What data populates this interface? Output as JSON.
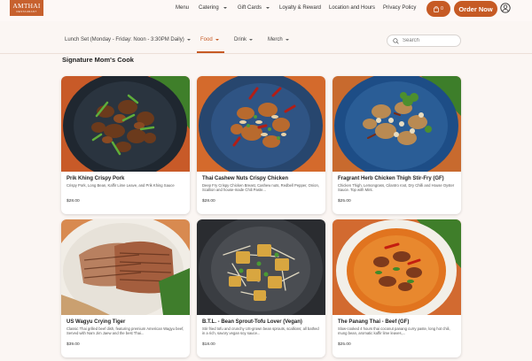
{
  "header": {
    "logo_main": "AMTHAI",
    "logo_sub": "RESTAURANT",
    "nav": [
      {
        "label": "Menu",
        "has_caret": false
      },
      {
        "label": "Catering",
        "has_caret": true
      },
      {
        "label": "Gift Cards",
        "has_caret": true
      },
      {
        "label": "Loyalty & Reward",
        "has_caret": false
      },
      {
        "label": "Location and Hours",
        "has_caret": false
      },
      {
        "label": "Privacy Policy",
        "has_caret": false
      }
    ],
    "cart_count": "0",
    "order_label": "Order Now",
    "account_icon": "user-circle-icon",
    "cart_icon": "shopping-bag-icon"
  },
  "categories": [
    {
      "label": "Lunch Set (Monday - Friday: Noon - 3:30PM Daily)",
      "active": false
    },
    {
      "label": "Food",
      "active": true
    },
    {
      "label": "Drink",
      "active": false
    },
    {
      "label": "Merch",
      "active": false
    }
  ],
  "search": {
    "placeholder": "Search",
    "value": "",
    "icon": "search-icon"
  },
  "section_title": "Signature Mom's Cook",
  "items": [
    {
      "name": "Prik Khing Crispy Pork",
      "description": "Crispy Pork, Long Bean, Kaffir Lime Leave, and Prik Khing Sauce",
      "price": "$28.00",
      "image": "dark-plate-crispy-pork"
    },
    {
      "name": "Thai Cashew Nuts Crispy Chicken",
      "description": "Deep Fry Crispy Chicken Breast, Cashew nuts, Redbell Pepper, Onion, Scallion and house-made Chili Paste...",
      "price": "$28.00",
      "image": "blue-plate-cashew-chicken"
    },
    {
      "name": "Fragrant Herb Chicken Thigh Stir-Fry (GF)",
      "description": "Chicken Thigh, Lemongrass, Cilantro root, Dry Chilli and House Oyster Sauce. Top with Mint.",
      "price": "$25.00",
      "image": "blue-plate-herb-chicken"
    },
    {
      "name": "US Wagyu Crying Tiger",
      "description": "Classic Thai grilled beef dish, featuring premium American Wagyu beef, Served with Nam Jim Jaew and the best Thai...",
      "price": "$39.00",
      "image": "white-plate-grilled-beef"
    },
    {
      "name": "B.T.L. - Bean Sprout-Tofu Lover (Vegan)",
      "description": "Stir fried tofu and crunchy US-grown bean sprouts, scallions; all bathed in a rich, savory vegan soy sauce...",
      "price": "$18.00",
      "image": "dark-plate-tofu-sprouts"
    },
    {
      "name": "The Panang Thai - Beef (GF)",
      "description": "Slow-cooked 4 hours thai coconut panang curry paste, long hot chili, mung bean, aromatic kaffir lime leaves,...",
      "price": "$25.00",
      "image": "white-bowl-panang-curry"
    }
  ],
  "colors": {
    "accent": "#c65a24",
    "background": "#fbf6f3"
  }
}
